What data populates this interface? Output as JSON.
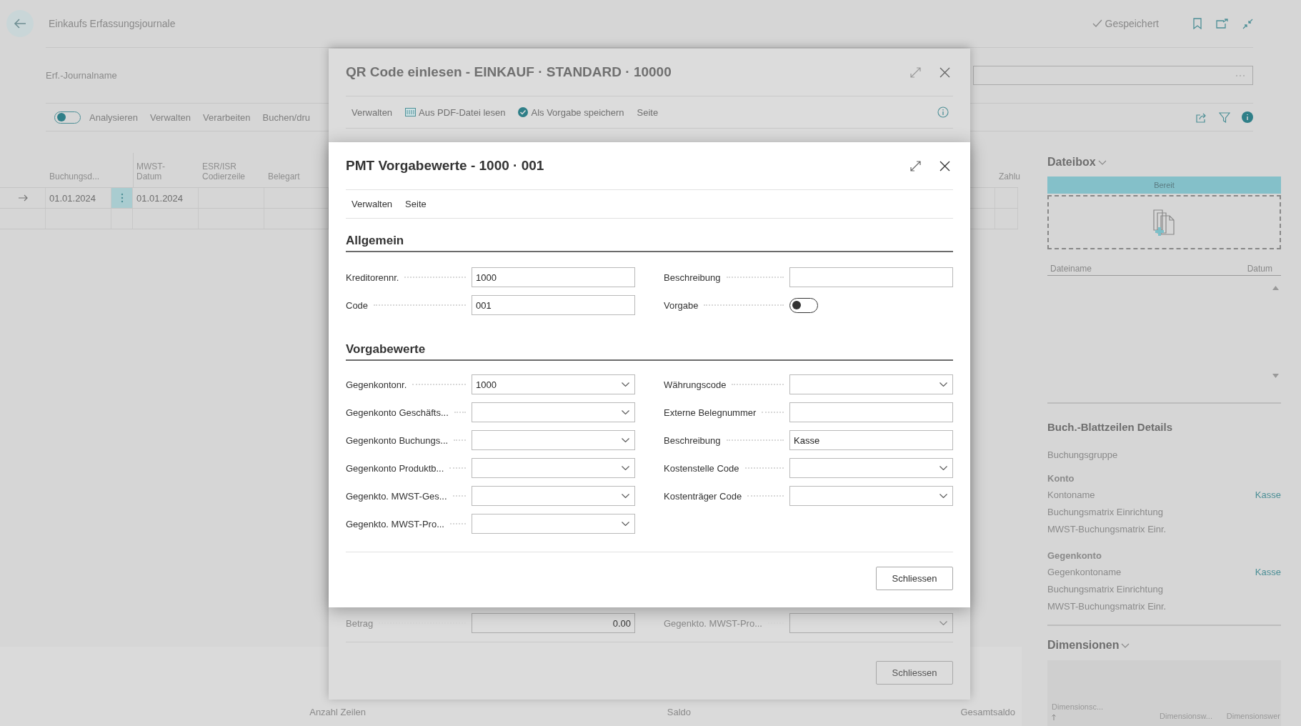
{
  "page": {
    "title": "Einkaufs Erfassungsjournale",
    "save_status": "Gespeichert",
    "journal_name_label": "Erf.-Journalname",
    "toolbar": {
      "toggle": {
        "label": "Analysieren",
        "on": false
      },
      "actions": [
        "Verwalten",
        "Verarbeiten",
        "Buchen/dru"
      ]
    },
    "table": {
      "columns": [
        {
          "lines": [
            "Buchungsd..."
          ]
        },
        {
          "lines": [
            "MWST-",
            "Datum"
          ]
        },
        {
          "lines": [
            "ESR/ISR",
            "Codierzeile"
          ]
        },
        {
          "lines": [
            "Belegart"
          ]
        },
        {
          "lines": [
            "Zahlu"
          ]
        }
      ],
      "rows": [
        {
          "selected": true,
          "cells": [
            "01.01.2024",
            "01.01.2024"
          ]
        },
        {
          "selected": false
        }
      ]
    },
    "footer": [
      "Anzahl Zeilen",
      "Saldo",
      "Gesamtsaldo"
    ]
  },
  "factbox": {
    "dateibox": {
      "title": "Dateibox",
      "status": "Bereit",
      "columns": [
        "Dateiname",
        "Datum"
      ]
    },
    "details": {
      "title": "Buch.-Blattzeilen Details",
      "posting_group": "Buchungsgruppe",
      "groups": [
        {
          "title": "Konto",
          "rows": [
            {
              "label": "Kontoname",
              "value": "Kasse"
            },
            {
              "label": "Buchungsmatrix Einrichtung"
            },
            {
              "label": "MWST-Buchungsmatrix Einr."
            }
          ]
        },
        {
          "title": "Gegenkonto",
          "rows": [
            {
              "label": "Gegenkontoname",
              "value": "Kasse"
            },
            {
              "label": "Buchungsmatrix Einrichtung"
            },
            {
              "label": "MWST-Buchungsmatrix Einr."
            }
          ]
        }
      ]
    },
    "dimensions": {
      "title": "Dimensionen",
      "columns": [
        "Dimensionsc...",
        "Dimensionsw...",
        "Dimensionswer"
      ]
    }
  },
  "qr_dialog": {
    "title": "QR Code einlesen - EINKAUF · STANDARD · 10000",
    "actions": [
      {
        "label": "Verwalten",
        "kind": "text"
      },
      {
        "label": "Aus PDF-Datei lesen",
        "kind": "pdf"
      },
      {
        "label": "Als Vorgabe speichern",
        "kind": "check"
      },
      {
        "label": "Seite",
        "kind": "text"
      }
    ],
    "fields": [
      {
        "label": "Betrag",
        "kind": "number",
        "value": "0.00"
      },
      {
        "label": "Gegenkto. MWST-Pro...",
        "kind": "dropdown"
      }
    ],
    "close_button": "Schliessen"
  },
  "pmt_dialog": {
    "title": "PMT Vorgabewerte - 1000 · 001",
    "actions": [
      "Verwalten",
      "Seite"
    ],
    "sections": [
      {
        "title": "Allgemein",
        "left": [
          {
            "label": "Kreditorennr.",
            "kind": "text",
            "value": "1000"
          },
          {
            "label": "Code",
            "kind": "text",
            "value": "001"
          }
        ],
        "right": [
          {
            "label": "Beschreibung",
            "kind": "text"
          },
          {
            "label": "Vorgabe",
            "kind": "toggle",
            "on": false
          }
        ]
      },
      {
        "title": "Vorgabewerte",
        "left": [
          {
            "label": "Gegenkontonr.",
            "kind": "dropdown",
            "value": "1000"
          },
          {
            "label": "Gegenkonto Geschäfts...",
            "kind": "dropdown"
          },
          {
            "label": "Gegenkonto Buchungs...",
            "kind": "dropdown"
          },
          {
            "label": "Gegenkonto Produktb...",
            "kind": "dropdown"
          },
          {
            "label": "Gegenkto. MWST-Ges...",
            "kind": "dropdown"
          },
          {
            "label": "Gegenkto. MWST-Pro...",
            "kind": "dropdown"
          }
        ],
        "right": [
          {
            "label": "Währungscode",
            "kind": "dropdown"
          },
          {
            "label": "Externe Belegnummer",
            "kind": "text"
          },
          {
            "label": "Beschreibung",
            "kind": "text",
            "value": "Kasse"
          },
          {
            "label": "Kostenstelle Code",
            "kind": "dropdown"
          },
          {
            "label": "Kostenträger Code",
            "kind": "dropdown"
          }
        ]
      }
    ],
    "close_button": "Schliessen"
  }
}
